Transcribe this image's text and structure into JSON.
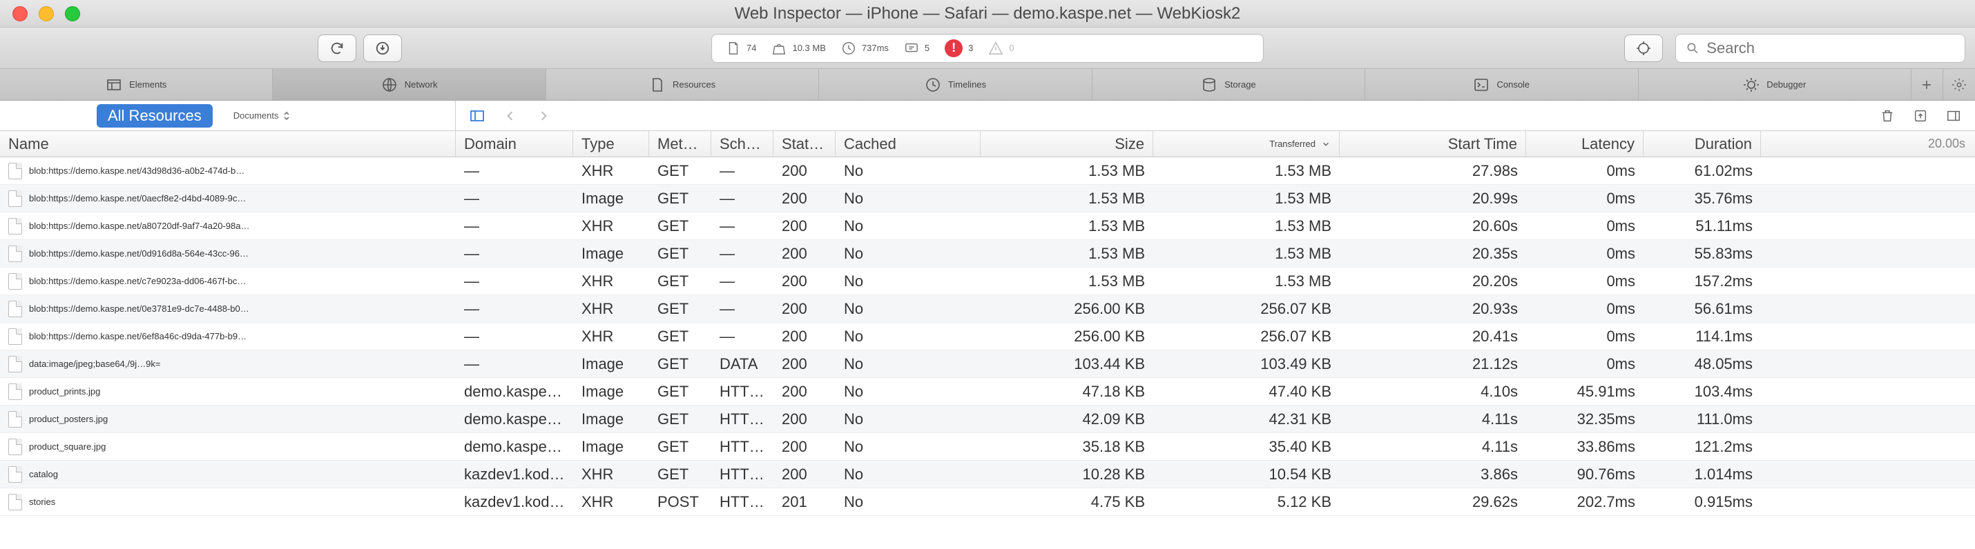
{
  "window": {
    "title": "Web Inspector — iPhone — Safari — demo.kaspe.net — WebKiosk2"
  },
  "stats": {
    "resource_count": "74",
    "transfer_size": "10.3 MB",
    "load_time": "737ms",
    "messages": "5",
    "errors": "3",
    "warnings": "0"
  },
  "search": {
    "placeholder": "Search"
  },
  "tabs": {
    "elements": "Elements",
    "network": "Network",
    "resources": "Resources",
    "timelines": "Timelines",
    "storage": "Storage",
    "console": "Console",
    "debugger": "Debugger"
  },
  "filters": {
    "all_resources": "All Resources",
    "documents": "Documents"
  },
  "columns": {
    "name": "Name",
    "domain": "Domain",
    "type": "Type",
    "method": "Met…",
    "scheme": "Sch…",
    "status": "Stat…",
    "cached": "Cached",
    "size": "Size",
    "transferred": "Transferred",
    "start_time": "Start Time",
    "latency": "Latency",
    "duration": "Duration",
    "waterfall_scale": "20.00s"
  },
  "rows": [
    {
      "name": "blob:https://demo.kaspe.net/43d98d36-a0b2-474d-b…",
      "domain": "—",
      "type": "XHR",
      "method": "GET",
      "scheme": "—",
      "status": "200",
      "cached": "No",
      "size": "1.53 MB",
      "transferred": "1.53 MB",
      "start": "27.98s",
      "latency": "0ms",
      "duration": "61.02ms",
      "wpos": 96
    },
    {
      "name": "blob:https://demo.kaspe.net/0aecf8e2-d4bd-4089-9c…",
      "domain": "—",
      "type": "Image",
      "method": "GET",
      "scheme": "—",
      "status": "200",
      "cached": "No",
      "size": "1.53 MB",
      "transferred": "1.53 MB",
      "start": "20.99s",
      "latency": "0ms",
      "duration": "35.76ms",
      "wpos": 78
    },
    {
      "name": "blob:https://demo.kaspe.net/a80720df-9af7-4a20-98a…",
      "domain": "—",
      "type": "XHR",
      "method": "GET",
      "scheme": "—",
      "status": "200",
      "cached": "No",
      "size": "1.53 MB",
      "transferred": "1.53 MB",
      "start": "20.60s",
      "latency": "0ms",
      "duration": "51.11ms",
      "wpos": 77
    },
    {
      "name": "blob:https://demo.kaspe.net/0d916d8a-564e-43cc-96…",
      "domain": "—",
      "type": "Image",
      "method": "GET",
      "scheme": "—",
      "status": "200",
      "cached": "No",
      "size": "1.53 MB",
      "transferred": "1.53 MB",
      "start": "20.35s",
      "latency": "0ms",
      "duration": "55.83ms",
      "wpos": 76
    },
    {
      "name": "blob:https://demo.kaspe.net/c7e9023a-dd06-467f-bc…",
      "domain": "—",
      "type": "XHR",
      "method": "GET",
      "scheme": "—",
      "status": "200",
      "cached": "No",
      "size": "1.53 MB",
      "transferred": "1.53 MB",
      "start": "20.20s",
      "latency": "0ms",
      "duration": "157.2ms",
      "wpos": 76
    },
    {
      "name": "blob:https://demo.kaspe.net/0e3781e9-dc7e-4488-b0…",
      "domain": "—",
      "type": "XHR",
      "method": "GET",
      "scheme": "—",
      "status": "200",
      "cached": "No",
      "size": "256.00 KB",
      "transferred": "256.07 KB",
      "start": "20.93s",
      "latency": "0ms",
      "duration": "56.61ms",
      "wpos": 78
    },
    {
      "name": "blob:https://demo.kaspe.net/6ef8a46c-d9da-477b-b9…",
      "domain": "—",
      "type": "XHR",
      "method": "GET",
      "scheme": "—",
      "status": "200",
      "cached": "No",
      "size": "256.00 KB",
      "transferred": "256.07 KB",
      "start": "20.41s",
      "latency": "0ms",
      "duration": "114.1ms",
      "wpos": 77
    },
    {
      "name": "data:image/jpeg;base64,/9j…9k=",
      "domain": "—",
      "type": "Image",
      "method": "GET",
      "scheme": "DATA",
      "status": "200",
      "cached": "No",
      "size": "103.44 KB",
      "transferred": "103.49 KB",
      "start": "21.12s",
      "latency": "0ms",
      "duration": "48.05ms",
      "wpos": 79
    },
    {
      "name": "product_prints.jpg",
      "domain": "demo.kaspe.…",
      "type": "Image",
      "method": "GET",
      "scheme": "HTT…",
      "status": "200",
      "cached": "No",
      "size": "47.18 KB",
      "transferred": "47.40 KB",
      "start": "4.10s",
      "latency": "45.91ms",
      "duration": "103.4ms",
      "wpos": 14
    },
    {
      "name": "product_posters.jpg",
      "domain": "demo.kaspe.…",
      "type": "Image",
      "method": "GET",
      "scheme": "HTT…",
      "status": "200",
      "cached": "No",
      "size": "42.09 KB",
      "transferred": "42.31 KB",
      "start": "4.11s",
      "latency": "32.35ms",
      "duration": "111.0ms",
      "wpos": 14
    },
    {
      "name": "product_square.jpg",
      "domain": "demo.kaspe.…",
      "type": "Image",
      "method": "GET",
      "scheme": "HTT…",
      "status": "200",
      "cached": "No",
      "size": "35.18 KB",
      "transferred": "35.40 KB",
      "start": "4.11s",
      "latency": "33.86ms",
      "duration": "121.2ms",
      "wpos": 14
    },
    {
      "name": "catalog",
      "domain": "kazdev1.kod…",
      "type": "XHR",
      "method": "GET",
      "scheme": "HTT…",
      "status": "200",
      "cached": "No",
      "size": "10.28 KB",
      "transferred": "10.54 KB",
      "start": "3.86s",
      "latency": "90.76ms",
      "duration": "1.014ms",
      "wpos": 13
    },
    {
      "name": "stories",
      "domain": "kazdev1.kod…",
      "type": "XHR",
      "method": "POST",
      "scheme": "HTT…",
      "status": "201",
      "cached": "No",
      "size": "4.75 KB",
      "transferred": "5.12 KB",
      "start": "29.62s",
      "latency": "202.7ms",
      "duration": "0.915ms",
      "wpos": 98
    }
  ]
}
